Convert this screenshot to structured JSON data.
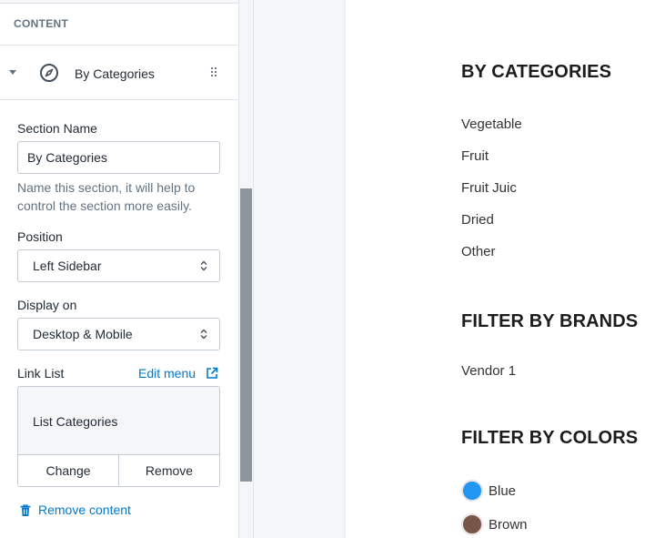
{
  "panel": {
    "header": "CONTENT",
    "section": {
      "title": "By Categories",
      "icon": "compass-icon"
    },
    "section_name": {
      "label": "Section Name",
      "value": "By Categories",
      "help": "Name this section, it will help to control the section more easily."
    },
    "position": {
      "label": "Position",
      "value": "Left Sidebar"
    },
    "display_on": {
      "label": "Display on",
      "value": "Desktop & Mobile"
    },
    "link_list": {
      "label": "Link List",
      "edit_label": "Edit menu",
      "value": "List Categories",
      "change_label": "Change",
      "remove_label": "Remove"
    },
    "remove_content": "Remove content"
  },
  "preview": {
    "categories": {
      "heading": "BY CATEGORIES",
      "items": [
        "Vegetable",
        "Fruit",
        "Fruit Juic",
        "Dried",
        "Other"
      ]
    },
    "brands": {
      "heading": "FILTER BY BRANDS",
      "items": [
        "Vendor 1"
      ]
    },
    "colors": {
      "heading": "FILTER BY COLORS",
      "items": [
        {
          "label": "Blue",
          "color": "#2196f3"
        },
        {
          "label": "Brown",
          "color": "#795548"
        }
      ]
    }
  }
}
